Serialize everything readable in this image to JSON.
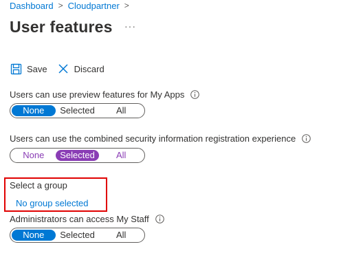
{
  "breadcrumb": {
    "items": [
      "Dashboard",
      "Cloudpartner"
    ],
    "separator": ">"
  },
  "page": {
    "title": "User features",
    "more_label": "···"
  },
  "toolbar": {
    "save_label": "Save",
    "discard_label": "Discard"
  },
  "settings": [
    {
      "label": "Users can use preview features for My Apps",
      "options": [
        "None",
        "Selected",
        "All"
      ],
      "selected": "None",
      "accent": "#0078d4"
    },
    {
      "label": "Users can use the combined security information registration experience",
      "options": [
        "None",
        "Selected",
        "All"
      ],
      "selected": "Selected",
      "accent": "#8a3db5"
    }
  ],
  "group": {
    "label": "Select a group",
    "value": "No group selected",
    "highlight_color": "#e00000"
  },
  "staff_setting": {
    "label": "Administrators can access My Staff",
    "options": [
      "None",
      "Selected",
      "All"
    ],
    "selected": "None",
    "accent": "#0078d4"
  },
  "colors": {
    "link": "#0078d4",
    "text": "#323130",
    "muted": "#605e5c"
  }
}
